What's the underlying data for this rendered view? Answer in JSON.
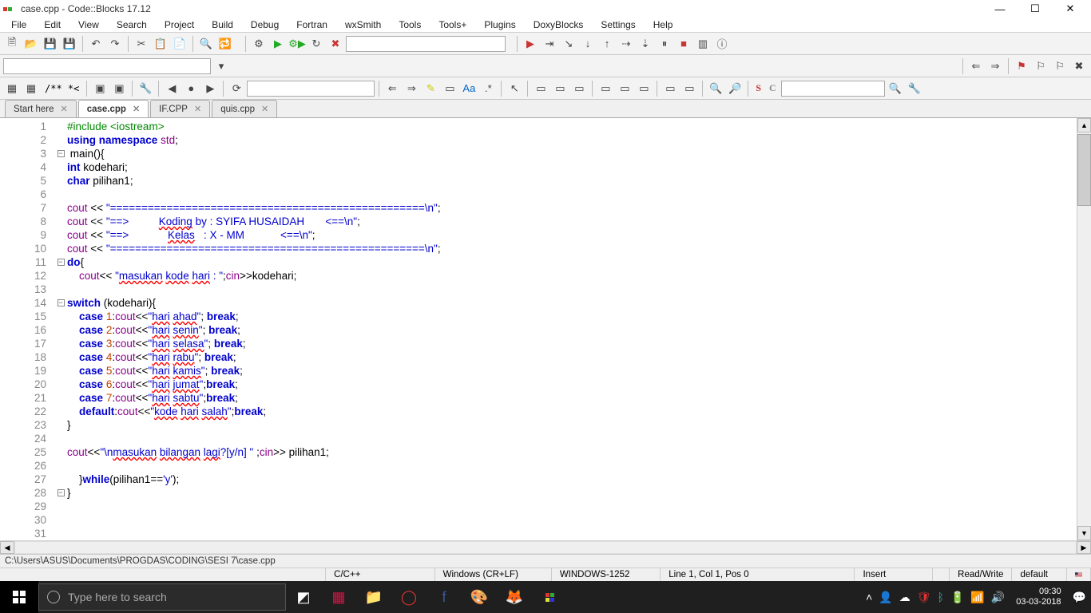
{
  "window": {
    "title": "case.cpp - Code::Blocks 17.12"
  },
  "menu": [
    "File",
    "Edit",
    "View",
    "Search",
    "Project",
    "Build",
    "Debug",
    "Fortran",
    "wxSmith",
    "Tools",
    "Tools+",
    "Plugins",
    "DoxyBlocks",
    "Settings",
    "Help"
  ],
  "tabs": [
    {
      "label": "Start here",
      "active": false
    },
    {
      "label": "case.cpp",
      "active": true
    },
    {
      "label": "IF.CPP",
      "active": false
    },
    {
      "label": "quis.cpp",
      "active": false
    }
  ],
  "code_lines": [
    {
      "n": 1,
      "html": "<span class='kw-green'>#include &lt;iostream&gt;</span>"
    },
    {
      "n": 2,
      "html": "<span class='kw-blue'>using</span> <span class='kw-blue'>namespace</span> <span class='kw-purple'>std</span>;"
    },
    {
      "n": 3,
      "fold": "-",
      "html": " main(){"
    },
    {
      "n": 4,
      "html": "<span class='kw-blue'>int</span> kodehari;"
    },
    {
      "n": 5,
      "html": "<span class='kw-blue'>char</span> pilihan1;"
    },
    {
      "n": 6,
      "html": ""
    },
    {
      "n": 7,
      "html": "<span class='kw-purple'>cout</span> &lt;&lt; <span class='str'>\"==================================================\\n\"</span>;"
    },
    {
      "n": 8,
      "html": "<span class='kw-purple'>cout</span> &lt;&lt; <span class='str'>\"==&gt;          </span><span class='str underline-red'>Koding</span><span class='str'> by : SYIFA HUSAIDAH       &lt;==\\n\"</span>;"
    },
    {
      "n": 9,
      "html": "<span class='kw-purple'>cout</span> &lt;&lt; <span class='str'>\"==&gt;             </span><span class='str underline-red'>Kelas</span><span class='str'>   : X - MM            &lt;==\\n\"</span>;"
    },
    {
      "n": 10,
      "html": "<span class='kw-purple'>cout</span> &lt;&lt; <span class='str'>\"==================================================\\n\"</span>;"
    },
    {
      "n": 11,
      "fold": "-",
      "html": "<span class='kw-blue'>do</span>{"
    },
    {
      "n": 12,
      "html": "    <span class='kw-purple'>cout</span>&lt;&lt; <span class='str'>\"</span><span class='str underline-red'>masukan</span><span class='str'> </span><span class='str underline-red'>kode</span><span class='str'> </span><span class='str underline-red'>hari</span><span class='str'> : \"</span>;<span class='kw-purple'>cin</span>&gt;&gt;kodehari;"
    },
    {
      "n": 13,
      "html": ""
    },
    {
      "n": 14,
      "fold": "-",
      "html": "<span class='kw-blue'>switch</span> (kodehari){"
    },
    {
      "n": 15,
      "html": "    <span class='kw-blue'>case</span> <span class='num'>1</span>:<span class='kw-purple'>cout</span>&lt;&lt;<span class='str'>\"</span><span class='str underline-red'>hari</span><span class='str'> </span><span class='str underline-red'>ahad</span><span class='str'>\"</span>; <span class='kw-blue'>break</span>;"
    },
    {
      "n": 16,
      "html": "    <span class='kw-blue'>case</span> <span class='num'>2</span>:<span class='kw-purple'>cout</span>&lt;&lt;<span class='str'>\"</span><span class='str underline-red'>hari</span><span class='str'> </span><span class='str underline-red'>senin</span><span class='str'>\"</span>; <span class='kw-blue'>break</span>;"
    },
    {
      "n": 17,
      "html": "    <span class='kw-blue'>case</span> <span class='num'>3</span>:<span class='kw-purple'>cout</span>&lt;&lt;<span class='str'>\"</span><span class='str underline-red'>hari</span><span class='str'> </span><span class='str underline-red'>selasa</span><span class='str'>\"</span>; <span class='kw-blue'>break</span>;"
    },
    {
      "n": 18,
      "html": "    <span class='kw-blue'>case</span> <span class='num'>4</span>:<span class='kw-purple'>cout</span>&lt;&lt;<span class='str'>\"</span><span class='str underline-red'>hari</span><span class='str'> </span><span class='str underline-red'>rabu</span><span class='str'>\"</span>; <span class='kw-blue'>break</span>;"
    },
    {
      "n": 19,
      "html": "    <span class='kw-blue'>case</span> <span class='num'>5</span>:<span class='kw-purple'>cout</span>&lt;&lt;<span class='str'>\"</span><span class='str underline-red'>hari</span><span class='str'> </span><span class='str underline-red'>kamis</span><span class='str'>\"</span>; <span class='kw-blue'>break</span>;"
    },
    {
      "n": 20,
      "html": "    <span class='kw-blue'>case</span> <span class='num'>6</span>:<span class='kw-purple'>cout</span>&lt;&lt;<span class='str'>\"</span><span class='str underline-red'>hari</span><span class='str'> </span><span class='str underline-red'>jumat</span><span class='str'>\"</span>;<span class='kw-blue'>break</span>;"
    },
    {
      "n": 21,
      "html": "    <span class='kw-blue'>case</span> <span class='num'>7</span>:<span class='kw-purple'>cout</span>&lt;&lt;<span class='str'>\"</span><span class='str underline-red'>hari</span><span class='str'> </span><span class='str underline-red'>sabtu</span><span class='str'>\"</span>;<span class='kw-blue'>break</span>;"
    },
    {
      "n": 22,
      "html": "    <span class='kw-blue'>default</span>:<span class='kw-purple'>cout</span>&lt;&lt;<span class='str'>\"</span><span class='str underline-red'>kode</span><span class='str'> </span><span class='str underline-red'>hari</span><span class='str'> </span><span class='str underline-red'>salah</span><span class='str'>\"</span>;<span class='kw-blue'>break</span>;"
    },
    {
      "n": 23,
      "html": "}"
    },
    {
      "n": 24,
      "html": ""
    },
    {
      "n": 25,
      "html": "<span class='kw-purple'>cout</span>&lt;&lt;<span class='str'>\"\\n</span><span class='str underline-red'>masukan</span><span class='str'> </span><span class='str underline-red'>bilangan</span><span class='str'> </span><span class='str underline-red'>lagi</span><span class='str'>?[y/n] \"</span> ;<span class='kw-purple'>cin</span>&gt;&gt; pilihan1;"
    },
    {
      "n": 26,
      "html": ""
    },
    {
      "n": 27,
      "html": "    }<span class='kw-blue'>while</span>(pilihan1==<span class='str'>'y'</span>);"
    },
    {
      "n": 28,
      "fold": "-",
      "html": "}"
    },
    {
      "n": 29,
      "html": ""
    },
    {
      "n": 30,
      "html": ""
    },
    {
      "n": 31,
      "html": ""
    }
  ],
  "status": {
    "path": "C:\\Users\\ASUS\\Documents\\PROGDAS\\CODING\\SESI 7\\case.cpp",
    "lang": "C/C++",
    "eol": "Windows (CR+LF)",
    "encoding": "WINDOWS-1252",
    "pos": "Line 1, Col 1, Pos 0",
    "insert": "Insert",
    "rw": "Read/Write",
    "default": "default"
  },
  "taskbar": {
    "search_placeholder": "Type here to search",
    "time": "09:30",
    "date": "03-03-2018"
  },
  "toolbar_text": {
    "comment": "/** *<",
    "s": "S",
    "c": "C"
  }
}
